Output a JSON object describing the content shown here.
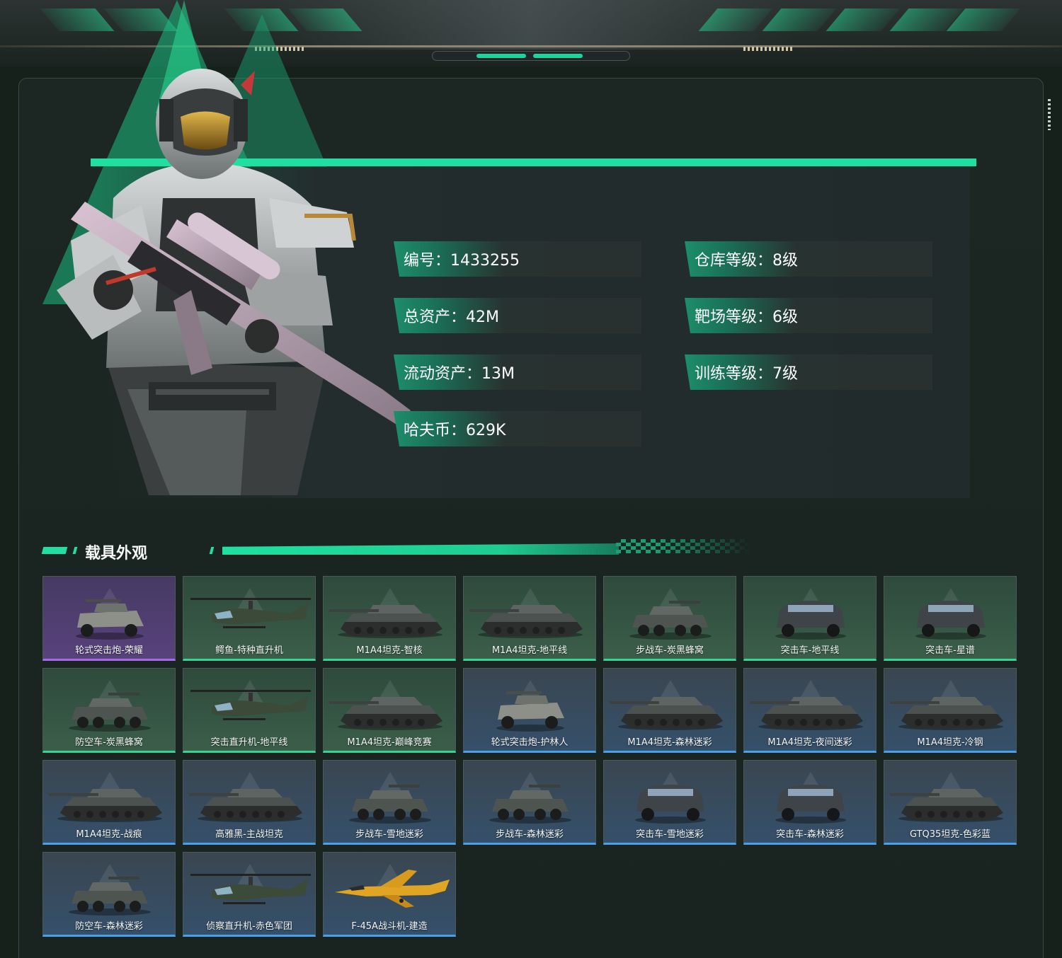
{
  "profile": {
    "stats": [
      {
        "label": "编号：1433255"
      },
      {
        "label": "仓库等级：8级"
      },
      {
        "label": "总资产：42M"
      },
      {
        "label": "靶场等级：6级"
      },
      {
        "label": "流动资产：13M"
      },
      {
        "label": "训练等级：7级"
      },
      {
        "label": "哈夫币：629K"
      }
    ]
  },
  "section": {
    "title": "载具外观"
  },
  "vehicles": [
    {
      "name": "轮式突击炮-荣耀",
      "rarity": "purple",
      "kind": "wheeled"
    },
    {
      "name": "鳄鱼-特种直升机",
      "rarity": "green",
      "kind": "heli"
    },
    {
      "name": "M1A4坦克-智核",
      "rarity": "green",
      "kind": "tank"
    },
    {
      "name": "M1A4坦克-地平线",
      "rarity": "green",
      "kind": "tank"
    },
    {
      "name": "步战车-炭黑蜂窝",
      "rarity": "green",
      "kind": "ifv"
    },
    {
      "name": "突击车-地平线",
      "rarity": "green",
      "kind": "car"
    },
    {
      "name": "突击车-星谱",
      "rarity": "green",
      "kind": "car"
    },
    {
      "name": "防空车-炭黑蜂窝",
      "rarity": "green",
      "kind": "ifv"
    },
    {
      "name": "突击直升机-地平线",
      "rarity": "green",
      "kind": "heli"
    },
    {
      "name": "M1A4坦克-巅峰竞赛",
      "rarity": "green",
      "kind": "tank"
    },
    {
      "name": "轮式突击炮-护林人",
      "rarity": "blue",
      "kind": "wheeled"
    },
    {
      "name": "M1A4坦克-森林迷彩",
      "rarity": "blue",
      "kind": "tank"
    },
    {
      "name": "M1A4坦克-夜间迷彩",
      "rarity": "blue",
      "kind": "tank"
    },
    {
      "name": "M1A4坦克-冷钢",
      "rarity": "blue",
      "kind": "tank"
    },
    {
      "name": "M1A4坦克-战痕",
      "rarity": "blue",
      "kind": "tank"
    },
    {
      "name": "高雅黑-主战坦克",
      "rarity": "blue",
      "kind": "tank"
    },
    {
      "name": "步战车-雪地迷彩",
      "rarity": "blue",
      "kind": "ifv"
    },
    {
      "name": "步战车-森林迷彩",
      "rarity": "blue",
      "kind": "ifv"
    },
    {
      "name": "突击车-雪地迷彩",
      "rarity": "blue",
      "kind": "car"
    },
    {
      "name": "突击车-森林迷彩",
      "rarity": "blue",
      "kind": "car"
    },
    {
      "name": "GTQ35坦克-色彩蓝",
      "rarity": "blue",
      "kind": "tank"
    },
    {
      "name": "防空车-森林迷彩",
      "rarity": "blue",
      "kind": "ifv"
    },
    {
      "name": "侦察直升机-赤色军团",
      "rarity": "blue",
      "kind": "heli"
    },
    {
      "name": "F-45A战斗机-建造",
      "rarity": "blue",
      "kind": "jet"
    }
  ],
  "colors": {
    "accent": "#1fe0a0",
    "purple": "#a36ce6",
    "green": "#32d592",
    "blue": "#4aa0e8"
  }
}
